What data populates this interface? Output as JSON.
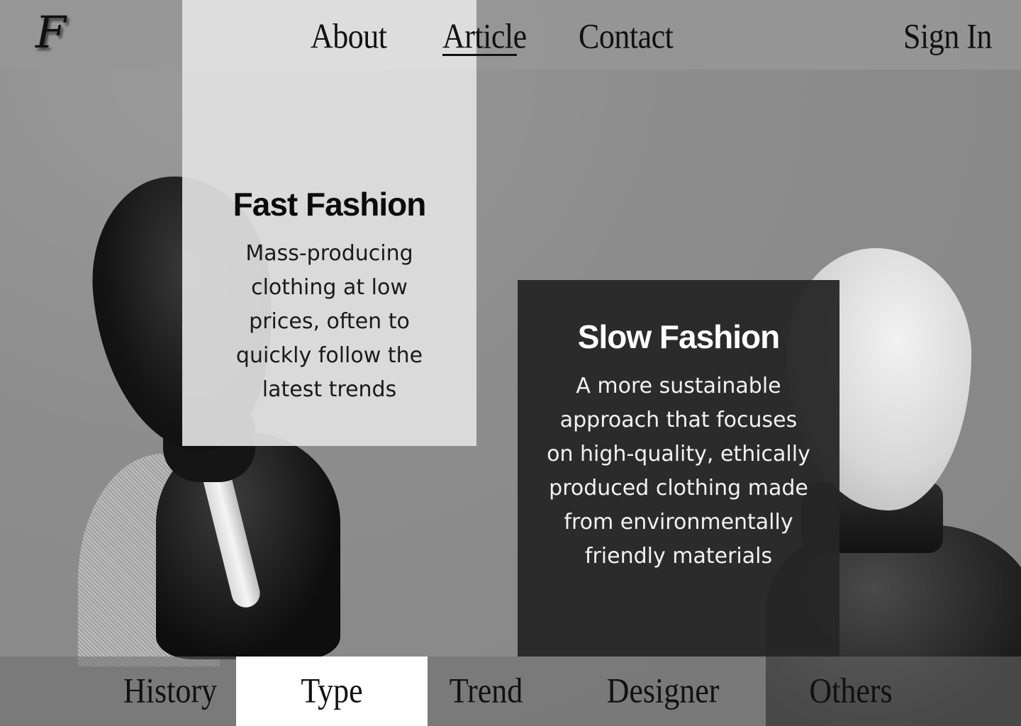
{
  "logo": {
    "text": "F"
  },
  "topnav": {
    "items": [
      {
        "label": "About"
      },
      {
        "label": "Article",
        "active": true
      },
      {
        "label": "Contact"
      }
    ],
    "sign_in": "Sign In"
  },
  "cards": {
    "fast": {
      "title": "Fast Fashion",
      "body": "Mass-producing clothing at low prices, often to quickly follow the latest trends"
    },
    "slow": {
      "title": "Slow Fashion",
      "body": "A more sustainable approach that focuses on high-quality, ethically produced clothing made from environmentally friendly materials"
    }
  },
  "bottomnav": {
    "tabs": [
      {
        "label": "History"
      },
      {
        "label": "Type",
        "active": true
      },
      {
        "label": "Trend"
      },
      {
        "label": "Designer"
      },
      {
        "label": "Others"
      }
    ]
  },
  "colors": {
    "active_tab_bg": "#ffffff",
    "slow_card_bg": "#262626",
    "fast_card_bg": "#e0e0e0"
  }
}
